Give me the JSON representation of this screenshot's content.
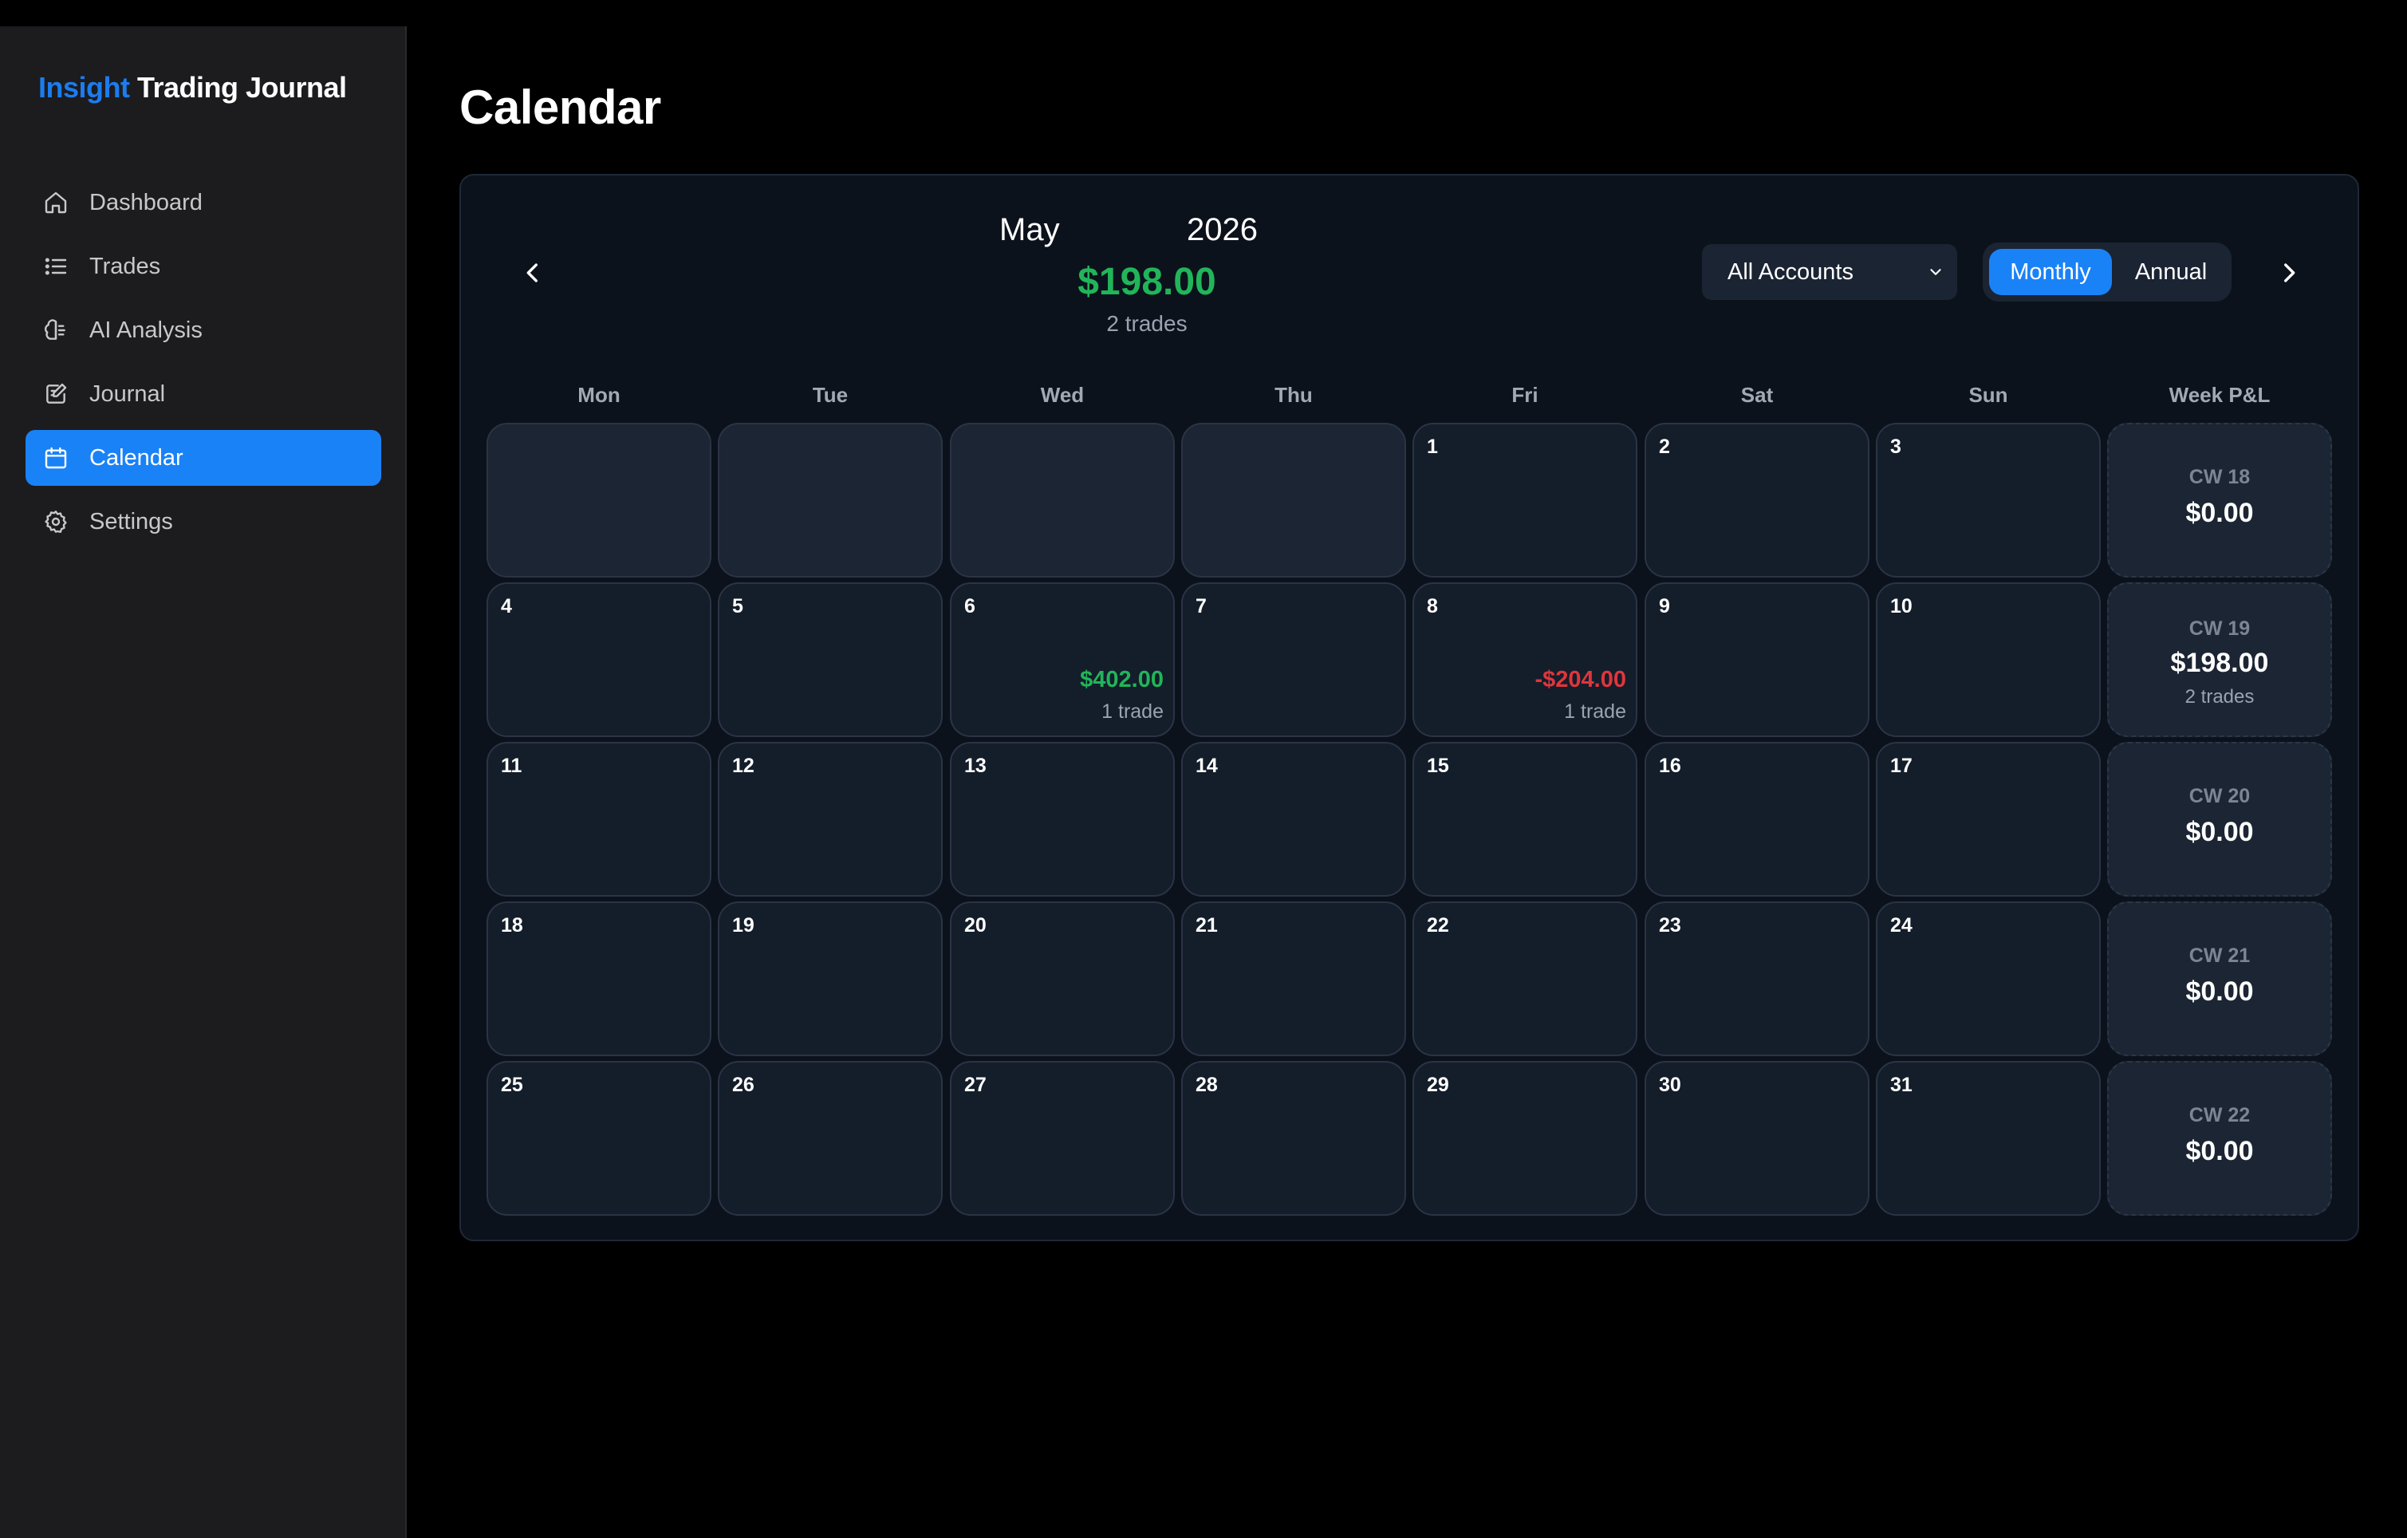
{
  "brand": {
    "accent": "Insight",
    "rest": "Trading Journal"
  },
  "sidebar": {
    "items": [
      {
        "label": "Dashboard",
        "icon": "home-icon",
        "active": false
      },
      {
        "label": "Trades",
        "icon": "list-icon",
        "active": false
      },
      {
        "label": "AI Analysis",
        "icon": "brain-icon",
        "active": false
      },
      {
        "label": "Journal",
        "icon": "edit-icon",
        "active": false
      },
      {
        "label": "Calendar",
        "icon": "calendar-icon",
        "active": true
      },
      {
        "label": "Settings",
        "icon": "gear-icon",
        "active": false
      }
    ]
  },
  "page": {
    "title": "Calendar"
  },
  "calendar": {
    "month": "May",
    "year": "2026",
    "total": "$198.00",
    "trades": "2 trades",
    "account_select": "All Accounts",
    "view_toggle": {
      "monthly": "Monthly",
      "annual": "Annual",
      "selected": "Monthly"
    },
    "day_headers": [
      "Mon",
      "Tue",
      "Wed",
      "Thu",
      "Fri",
      "Sat",
      "Sun",
      "Week P&L"
    ],
    "weeks": [
      {
        "days": [
          {
            "day": ""
          },
          {
            "day": ""
          },
          {
            "day": ""
          },
          {
            "day": ""
          },
          {
            "day": "1"
          },
          {
            "day": "2"
          },
          {
            "day": "3"
          }
        ],
        "week_summary": {
          "label": "CW 18",
          "pnl": "$0.00",
          "trades": ""
        }
      },
      {
        "days": [
          {
            "day": "4"
          },
          {
            "day": "5"
          },
          {
            "day": "6",
            "pnl": "$402.00",
            "trades": "1 trade",
            "sign": "pos"
          },
          {
            "day": "7"
          },
          {
            "day": "8",
            "pnl": "-$204.00",
            "trades": "1 trade",
            "sign": "neg"
          },
          {
            "day": "9"
          },
          {
            "day": "10"
          }
        ],
        "week_summary": {
          "label": "CW 19",
          "pnl": "$198.00",
          "trades": "2 trades",
          "sign": "pos"
        }
      },
      {
        "days": [
          {
            "day": "11"
          },
          {
            "day": "12"
          },
          {
            "day": "13"
          },
          {
            "day": "14"
          },
          {
            "day": "15"
          },
          {
            "day": "16"
          },
          {
            "day": "17"
          }
        ],
        "week_summary": {
          "label": "CW 20",
          "pnl": "$0.00",
          "trades": ""
        }
      },
      {
        "days": [
          {
            "day": "18"
          },
          {
            "day": "19"
          },
          {
            "day": "20"
          },
          {
            "day": "21"
          },
          {
            "day": "22"
          },
          {
            "day": "23"
          },
          {
            "day": "24"
          }
        ],
        "week_summary": {
          "label": "CW 21",
          "pnl": "$0.00",
          "trades": ""
        }
      },
      {
        "days": [
          {
            "day": "25"
          },
          {
            "day": "26"
          },
          {
            "day": "27"
          },
          {
            "day": "28"
          },
          {
            "day": "29"
          },
          {
            "day": "30"
          },
          {
            "day": "31"
          }
        ],
        "week_summary": {
          "label": "CW 22",
          "pnl": "$0.00",
          "trades": ""
        }
      }
    ]
  },
  "colors": {
    "accent": "#1a82f7",
    "profit": "#21b559",
    "loss": "#e0353c",
    "sidebar_bg": "#1c1c1e",
    "panel_bg": "#0c121c"
  }
}
